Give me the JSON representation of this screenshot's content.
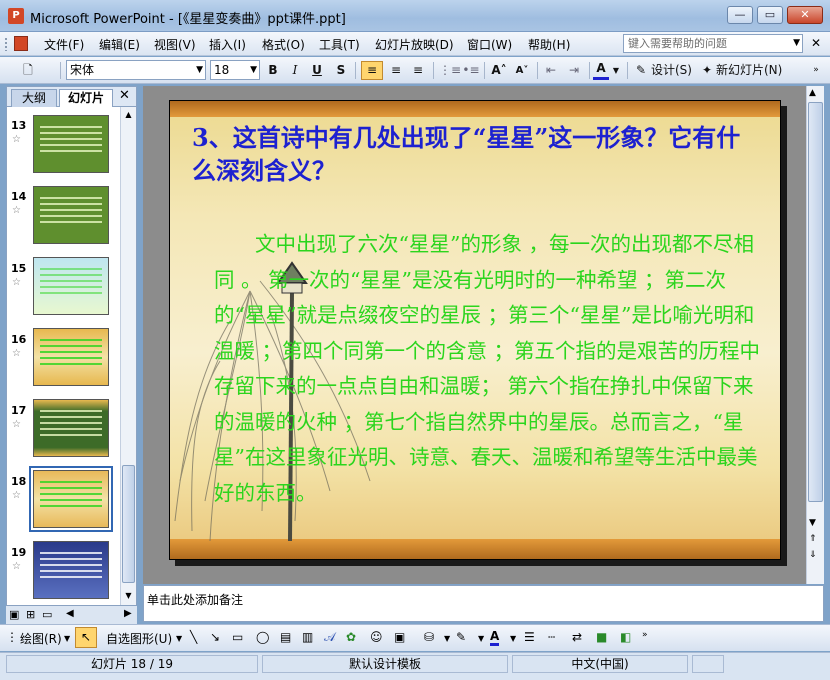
{
  "window": {
    "title": "Microsoft PowerPoint - [《星星变奏曲》ppt课件.ppt]",
    "app_icon": "P",
    "buttons": {
      "minimize": "—",
      "restore": "▭",
      "close": "✕"
    }
  },
  "menu": {
    "items": [
      "文件(F)",
      "编辑(E)",
      "视图(V)",
      "插入(I)",
      "格式(O)",
      "工具(T)",
      "幻灯片放映(D)",
      "窗口(W)",
      "帮助(H)"
    ],
    "help_placeholder": "键入需要帮助的问题",
    "close_glyph": "✕"
  },
  "format_toolbar": {
    "font_name": "宋体",
    "font_size": "18",
    "bold": "B",
    "italic": "I",
    "underline": "U",
    "shadow": "S",
    "design_label": "设计(S)",
    "new_slide_label": "新幻灯片(N)"
  },
  "left_pane": {
    "tabs": [
      "大纲",
      "幻灯片"
    ],
    "close_glyph": "✕",
    "slides": [
      {
        "number": "13",
        "bg": "#5f8f2e"
      },
      {
        "number": "14",
        "bg": "#5f8f2e"
      },
      {
        "number": "15",
        "bg": "#bfe6f0"
      },
      {
        "number": "16",
        "bg": "#e7b84f"
      },
      {
        "number": "17",
        "bg": "#3d6b28"
      },
      {
        "number": "18",
        "bg": "#e8b95a",
        "selected": true
      },
      {
        "number": "19",
        "bg": "#2a3a8a"
      }
    ],
    "star": "☆"
  },
  "slide": {
    "question": "3、这首诗中有几处出现了“星星”这一形象？它有什么深刻含义？",
    "body": "文中出现了六次“星星”的形象 ，每一次的出现都不尽相同 。 第一次的“星星”是没有光明时的一种希望 ；第二次的“星星”就是点缀夜空的星辰 ；第三个“星星”是比喻光明和温暖 ；第四个同第一个的含意 ；第五个指的是艰苦的历程中存留下来的一点点自由和温暖； 第六个指在挣扎中保留下来的温暖的火种 ；第七个指自然界中的星辰。总而言之，“星星”在这里象征光明、诗意、春天、温暖和希望等生活中最美好的东西。",
    "colors": {
      "question": "#1d21d0",
      "body": "#2bd51d"
    }
  },
  "notes": {
    "placeholder": "单击此处添加备注"
  },
  "draw_toolbar": {
    "draw_label": "绘图(R)",
    "autoshape_label": "自选图形(U)"
  },
  "status": {
    "slide_position": "幻灯片 18 / 19",
    "template": "默认设计模板",
    "language": "中文(中国)"
  }
}
